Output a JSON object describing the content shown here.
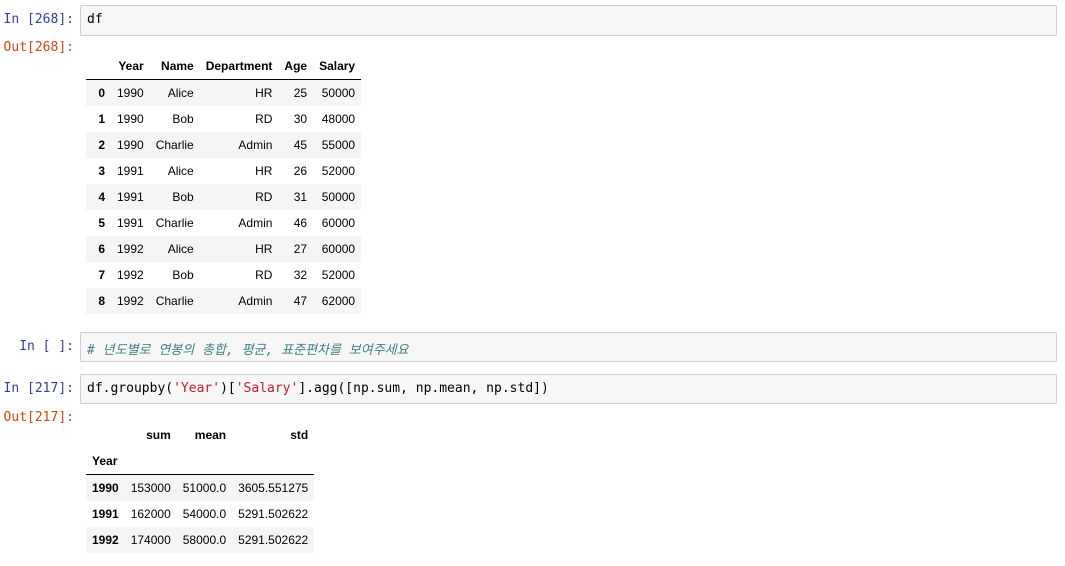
{
  "cells": {
    "c1": {
      "in_prompt": "In [268]:",
      "code": "df",
      "out_prompt": "Out[268]:"
    },
    "c2": {
      "in_prompt": "In [ ]:",
      "comment": "# 년도별로 연봉의 총합, 평균, 표준편차를 보여주세요"
    },
    "c3": {
      "in_prompt": "In [217]:",
      "code_parts": [
        "df.groupby(",
        "'Year'",
        ")[",
        "'Salary'",
        "].agg([np.sum, np.mean, np.std])"
      ],
      "out_prompt": "Out[217]:"
    }
  },
  "df_table": {
    "columns": [
      "",
      "Year",
      "Name",
      "Department",
      "Age",
      "Salary"
    ],
    "rows": [
      [
        "0",
        "1990",
        "Alice",
        "HR",
        "25",
        "50000"
      ],
      [
        "1",
        "1990",
        "Bob",
        "RD",
        "30",
        "48000"
      ],
      [
        "2",
        "1990",
        "Charlie",
        "Admin",
        "45",
        "55000"
      ],
      [
        "3",
        "1991",
        "Alice",
        "HR",
        "26",
        "52000"
      ],
      [
        "4",
        "1991",
        "Bob",
        "RD",
        "31",
        "50000"
      ],
      [
        "5",
        "1991",
        "Charlie",
        "Admin",
        "46",
        "60000"
      ],
      [
        "6",
        "1992",
        "Alice",
        "HR",
        "27",
        "60000"
      ],
      [
        "7",
        "1992",
        "Bob",
        "RD",
        "32",
        "52000"
      ],
      [
        "8",
        "1992",
        "Charlie",
        "Admin",
        "47",
        "62000"
      ]
    ]
  },
  "agg_table": {
    "columns": [
      "",
      "sum",
      "mean",
      "std"
    ],
    "index_name": "Year",
    "rows": [
      [
        "1990",
        "153000",
        "51000.0",
        "3605.551275"
      ],
      [
        "1991",
        "162000",
        "54000.0",
        "5291.502622"
      ],
      [
        "1992",
        "174000",
        "58000.0",
        "5291.502622"
      ]
    ]
  },
  "colors": {
    "in_prompt": "#303f9f",
    "out_prompt": "#d84315",
    "comment": "#408080",
    "string": "#ba2121"
  }
}
